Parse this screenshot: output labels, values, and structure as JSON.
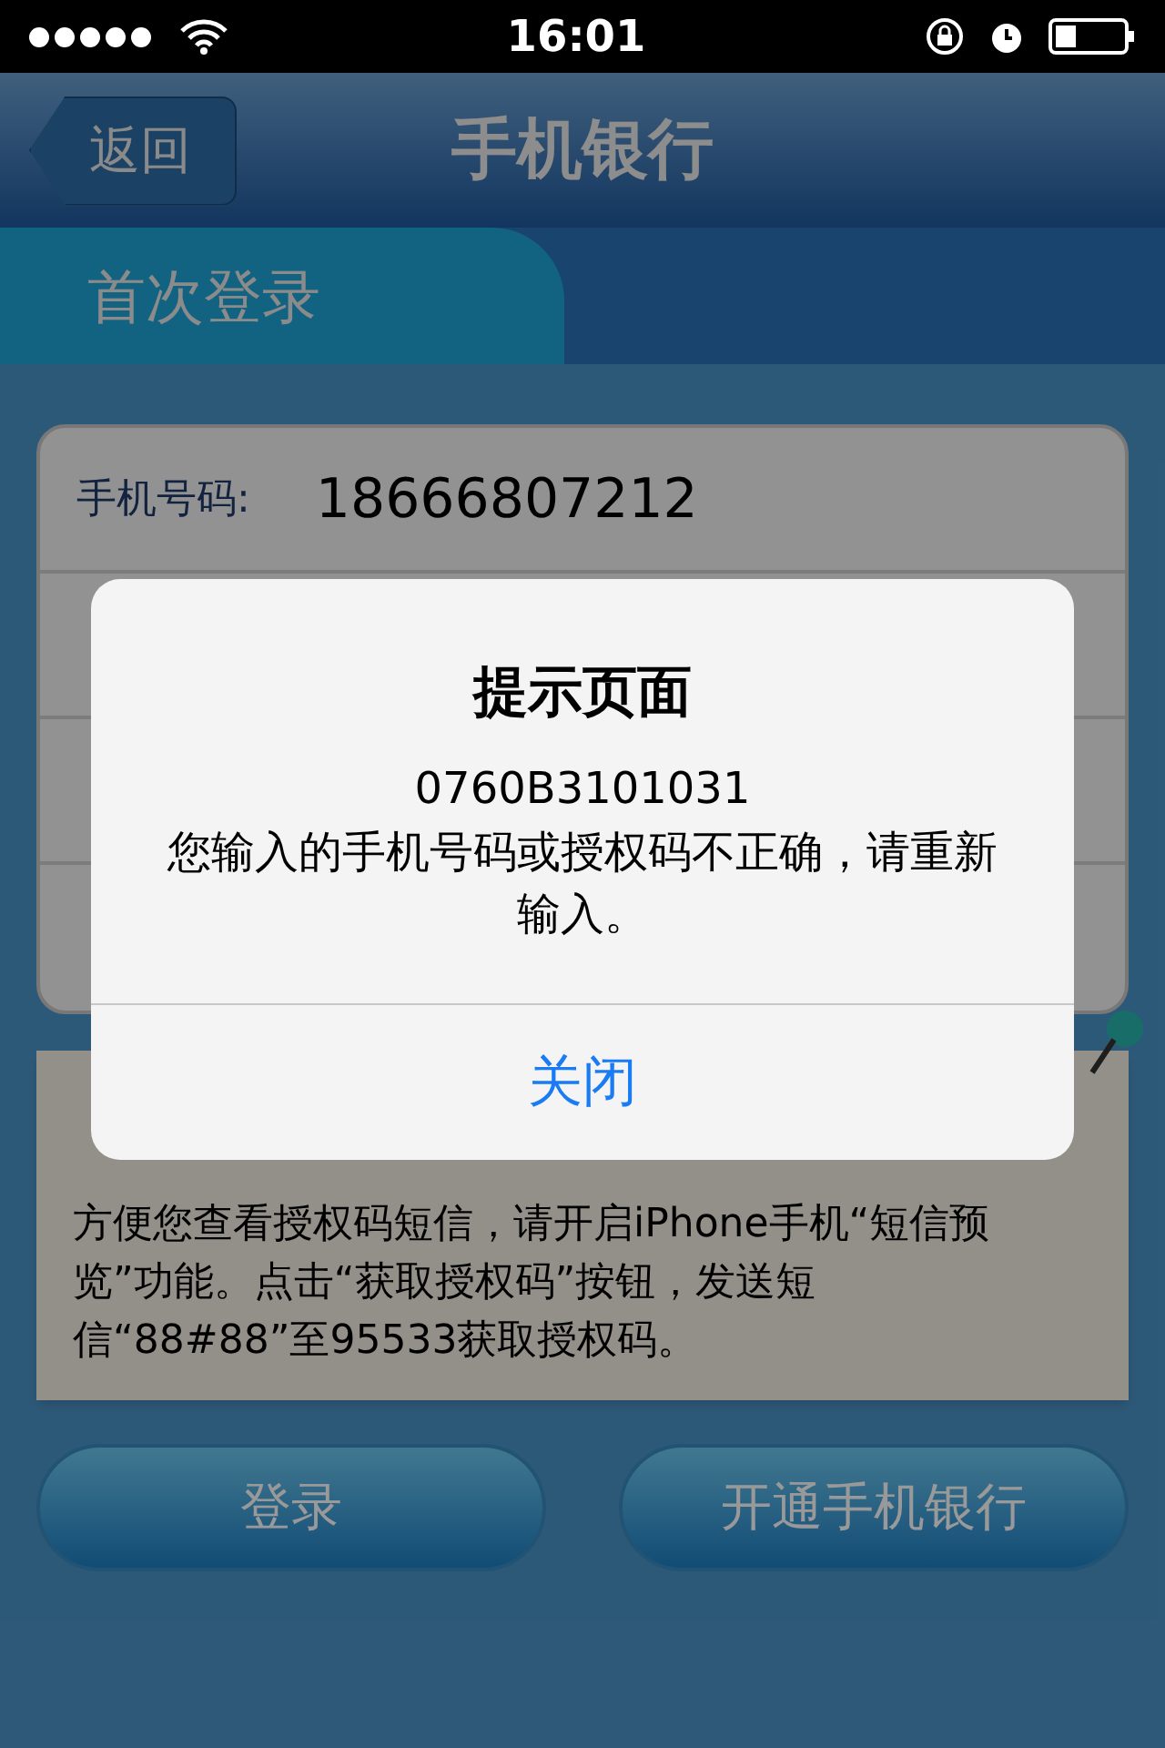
{
  "status_bar": {
    "time": "16:01"
  },
  "nav": {
    "back": "返回",
    "title": "手机银行"
  },
  "tabs": [
    {
      "label": "首次登录",
      "selected": true
    }
  ],
  "form": {
    "rows": [
      {
        "kind": "text",
        "label": "手机号码:",
        "value": "18666807212"
      }
    ]
  },
  "note": {
    "lines": [
      "方便您查看授权码短信，请开启iPhone手机“短信预",
      "览”功能。点击“获取授权码”按钮，发送短",
      "信“88#88”至95533获取授权码。"
    ]
  },
  "buttons": [
    "登录",
    "开通手机银行"
  ],
  "alert": {
    "title": "提示页面",
    "code": "0760B3101031",
    "message": "您输入的手机号码或授权码不正确，请重新输入。",
    "button": "关闭"
  }
}
